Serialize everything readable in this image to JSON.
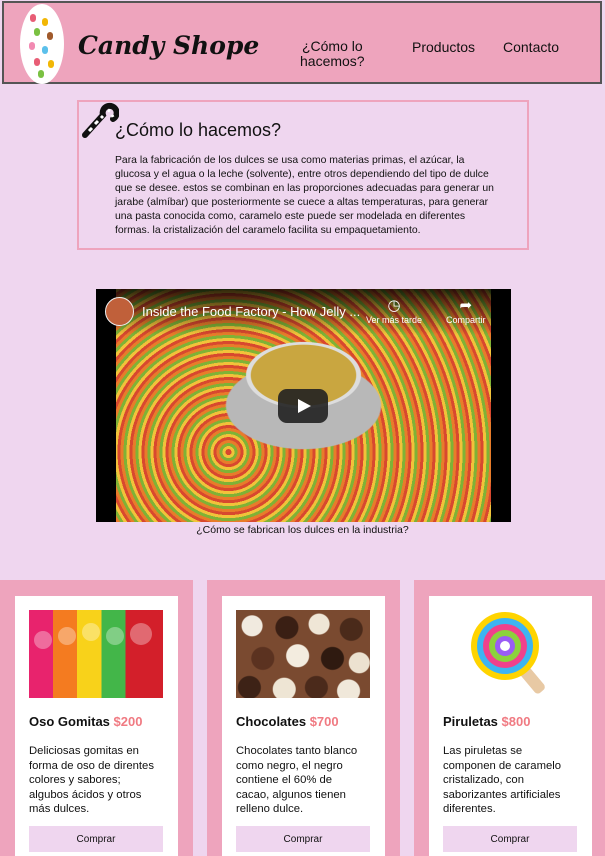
{
  "header": {
    "brand": "Candy Shope",
    "nav": [
      "¿Cómo lo\nhacemos?",
      "Productos",
      "Contacto"
    ]
  },
  "about": {
    "title": "¿Cómo lo hacemos?",
    "text": "Para la fabricación de los dulces se usa como materias primas, el azúcar, la glucosa y el agua o la leche (solvente), entre otros dependiendo del tipo de dulce que se desee. estos se combinan en las proporciones adecuadas para generar un jarabe (almíbar) que posteriormente se cuece a altas temperaturas, para generar una pasta conocida como, caramelo este puede ser modelada en diferentes formas. la cristalización del caramelo facilita su empaquetamiento."
  },
  "video": {
    "title": "Inside the Food Factory - How Jelly ...",
    "watch_later": "Ver más tarde",
    "share": "Compartir",
    "caption": "¿Cómo se fabrican los dulces en la industria?"
  },
  "products": [
    {
      "name": "Oso Gomitas",
      "price": "$200",
      "description": "Deliciosas gomitas en forma de oso de direntes colores y sabores; algubos ácidos y otros más dulces.",
      "button": "Comprar"
    },
    {
      "name": "Chocolates",
      "price": "$700",
      "description": "Chocolates tanto blanco como negro, el negro contiene el 60% de cacao, algunos tienen relleno dulce.",
      "button": "Comprar"
    },
    {
      "name": "Piruletas",
      "price": "$800",
      "description": "Las piruletas se componen de caramelo cristalizado, con saborizantes artificiales diferentes.",
      "button": "Comprar"
    }
  ],
  "colors": {
    "header_bg": "#eea4bd",
    "page_bg": "#efd6ef",
    "price": "#f07a82"
  }
}
